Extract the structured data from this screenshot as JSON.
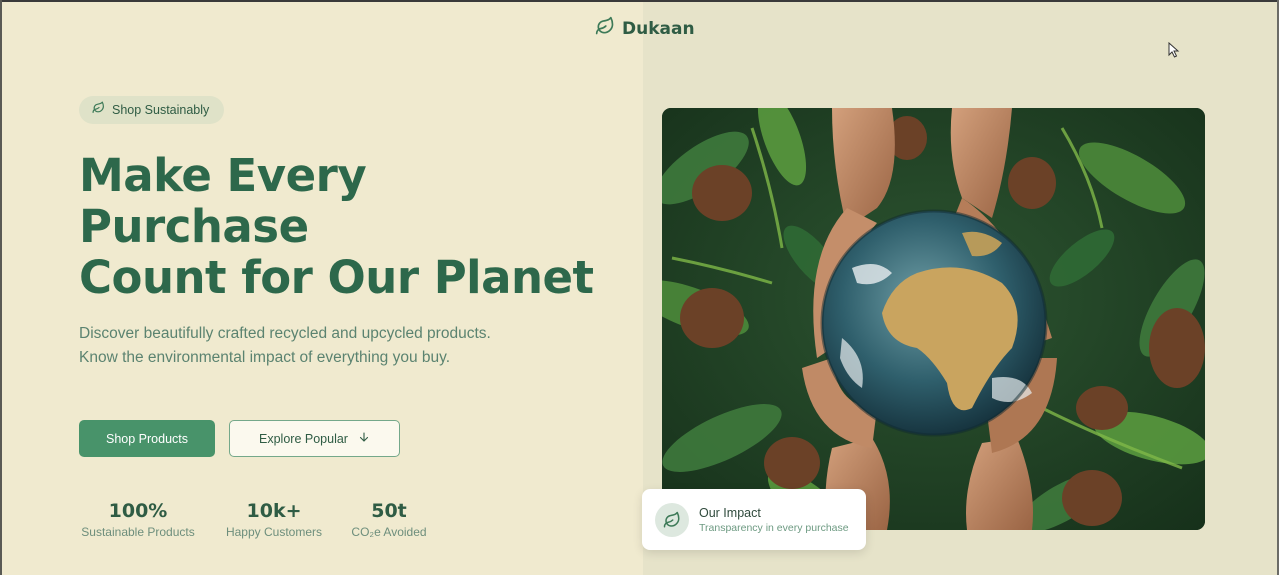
{
  "brand": {
    "name": "Dukaan",
    "icon": "leaf-icon"
  },
  "badge": {
    "label": "Shop Sustainably",
    "icon": "leaf-icon"
  },
  "hero": {
    "headline_lines": [
      "Make Every",
      "Purchase",
      "Count for Our Planet"
    ],
    "description": "Discover beautifully crafted recycled and upcycled products. Know the environmental impact of everything you buy."
  },
  "buttons": {
    "primary_label": "Shop Products",
    "secondary_label": "Explore Popular",
    "secondary_icon": "arrow-down-icon"
  },
  "stats": [
    {
      "value": "100%",
      "label": "Sustainable Products"
    },
    {
      "value": "10k+",
      "label": "Happy Customers"
    },
    {
      "value": "50t",
      "label": "CO₂e Avoided"
    }
  ],
  "impact_card": {
    "title": "Our Impact",
    "subtitle": "Transparency in every purchase",
    "icon": "leaf-icon"
  },
  "colors": {
    "background": "#f0eacf",
    "right_panel": "#e6e3c9",
    "primary": "#48936a",
    "heading": "#2d684b"
  }
}
